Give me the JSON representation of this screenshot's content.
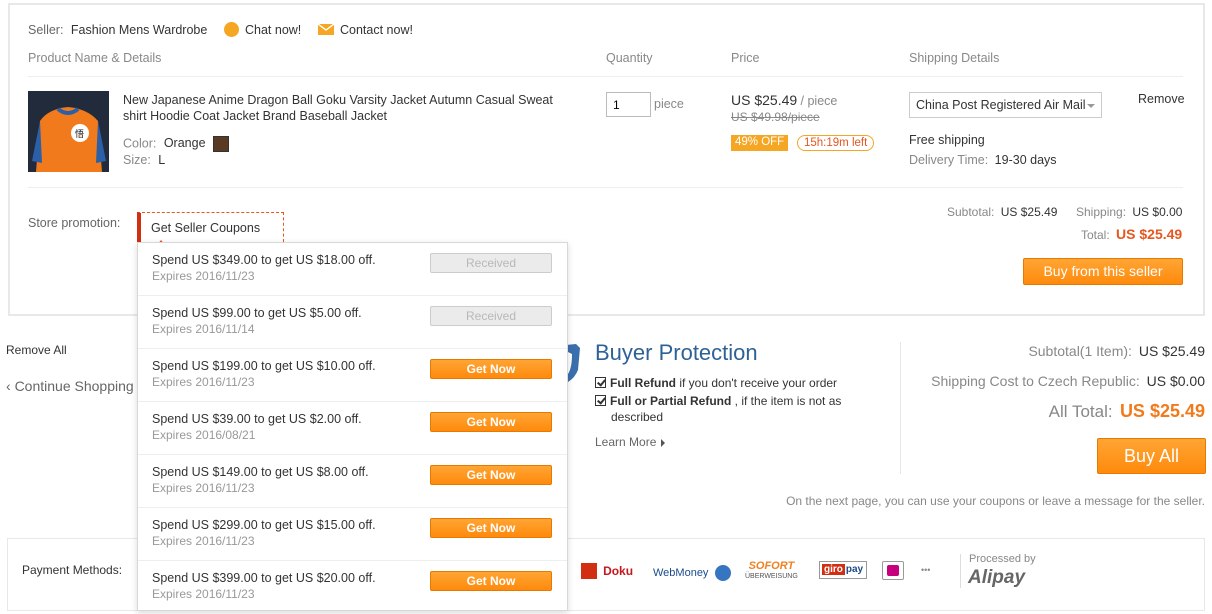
{
  "seller": {
    "label": "Seller:",
    "name": "Fashion Mens Wardrobe",
    "chat": "Chat now!",
    "contact": "Contact now!"
  },
  "columns": {
    "product": "Product Name & Details",
    "quantity": "Quantity",
    "price": "Price",
    "shipping": "Shipping Details"
  },
  "product": {
    "title_line1": "New Japanese Anime Dragon Ball Goku Varsity Jacket Autumn Casual Sweat",
    "title_line2": "shirt Hoodie Coat Jacket Brand Baseball Jacket",
    "color_label": "Color:",
    "color_value": "Orange",
    "size_label": "Size:",
    "size_value": "L",
    "qty_value": "1",
    "qty_unit": "piece",
    "price": "US $25.49",
    "price_unit": "/ piece",
    "old_price": "US $49.98/piece",
    "discount": "49% OFF",
    "timer": "15h:19m left",
    "shipping_method": "China Post Registered Air Mail",
    "free_shipping": "Free shipping",
    "delivery_label": "Delivery Time:",
    "delivery_value": "19-30 days",
    "remove": "Remove"
  },
  "store": {
    "promotion_label": "Store promotion:",
    "coupon_trigger": "Get Seller Coupons",
    "subtotal_label": "Subtotal:",
    "subtotal_value": "US $25.49",
    "shipping_label": "Shipping:",
    "shipping_value": "US $0.00",
    "total_label": "Total:",
    "total_value": "US $25.49",
    "buy_button": "Buy from this seller"
  },
  "coupons": [
    {
      "title": "Spend US $349.00 to get US $18.00 off.",
      "expires": "Expires 2016/11/23",
      "button": "Received",
      "received": true
    },
    {
      "title": "Spend US $99.00 to get US $5.00 off.",
      "expires": "Expires 2016/11/14",
      "button": "Received",
      "received": true
    },
    {
      "title": "Spend US $199.00 to get US $10.00 off.",
      "expires": "Expires 2016/11/23",
      "button": "Get Now",
      "received": false
    },
    {
      "title": "Spend US $39.00 to get US $2.00 off.",
      "expires": "Expires 2016/08/21",
      "button": "Get Now",
      "received": false
    },
    {
      "title": "Spend US $149.00 to get US $8.00 off.",
      "expires": "Expires 2016/11/23",
      "button": "Get Now",
      "received": false
    },
    {
      "title": "Spend US $299.00 to get US $15.00 off.",
      "expires": "Expires 2016/11/23",
      "button": "Get Now",
      "received": false
    },
    {
      "title": "Spend US $399.00 to get US $20.00 off.",
      "expires": "Expires 2016/11/23",
      "button": "Get Now",
      "received": false
    }
  ],
  "cart": {
    "remove_all": "Remove All",
    "continue": "Continue Shopping"
  },
  "protection": {
    "title": "Buyer Protection",
    "item1_bold": "Full Refund",
    "item1_rest": " if you don't receive your order",
    "item2_bold": "Full or Partial Refund",
    "item2_rest": " , if the item is not as",
    "item2_line2": "described",
    "learn_more": "Learn More"
  },
  "summary": {
    "subtotal_label": "Subtotal(1 Item):",
    "subtotal_value": "US $25.49",
    "shipping_label": "Shipping Cost to Czech Republic:",
    "shipping_value": "US $0.00",
    "total_label": "All Total:",
    "total_value": "US $25.49",
    "buy_all": "Buy All",
    "note": "On the next page, you can use your coupons or leave a message for the seller."
  },
  "payment": {
    "label": "Payment Methods:",
    "doku": "Doku",
    "webmoney": "WebMoney",
    "sofort": "SOFORT",
    "sofort_sub": "ÜBERWEISUNG",
    "giro_a": "giro",
    "giro_b": "pay",
    "more": "•••",
    "processed_by": "Processed by",
    "alipay": "Alipay"
  },
  "colors": {
    "accent_orange": "#ff9712",
    "price_red": "#e5571f",
    "protection_blue": "#2e6296"
  },
  "icons": [
    "chat-icon",
    "mail-icon",
    "shield-icon",
    "check-icon",
    "chevron-right-icon",
    "chevron-left-icon"
  ]
}
